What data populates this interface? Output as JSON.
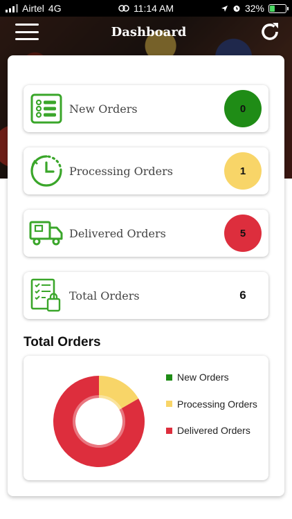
{
  "status_bar": {
    "carrier": "Airtel",
    "network": "4G",
    "time": "11:14 AM",
    "battery": "32%",
    "battery_level": 0.32
  },
  "app_bar": {
    "title": "Dashboard",
    "menu_icon": "hamburger-icon",
    "refresh_icon": "refresh-icon"
  },
  "orders": [
    {
      "label": "New Orders",
      "count": "0",
      "color": "#1f8c16",
      "icon": "list-icon"
    },
    {
      "label": "Processing Orders",
      "count": "1",
      "color": "#f8d568",
      "icon": "clock-icon"
    },
    {
      "label": "Delivered Orders",
      "count": "5",
      "color": "#dd2e3d",
      "icon": "truck-icon"
    },
    {
      "label": "Total Orders",
      "count": "6",
      "color": "",
      "icon": "checklist-bag-icon"
    }
  ],
  "chart_section": {
    "title": "Total Orders"
  },
  "chart_data": {
    "type": "pie",
    "donut": true,
    "title": "",
    "categories": [
      "New Orders",
      "Processing Orders",
      "Delivered Orders"
    ],
    "values": [
      0,
      1,
      5
    ],
    "colors": [
      "#1f8c16",
      "#f8d568",
      "#dd2e3d"
    ],
    "legend_position": "right"
  },
  "colors": {
    "accent_green": "#3aa62a"
  }
}
